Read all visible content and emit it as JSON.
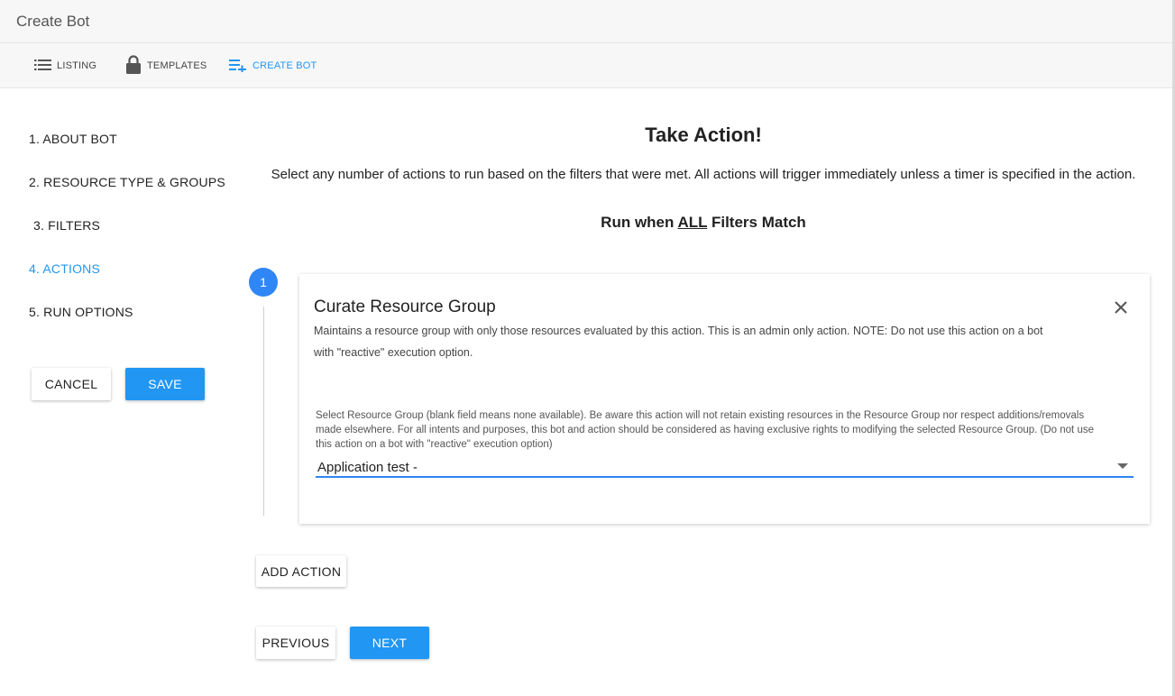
{
  "window": {
    "title": "Create Bot"
  },
  "nav": {
    "listing": {
      "label": "LISTING",
      "icon": "list-icon"
    },
    "templates": {
      "label": "TEMPLATES",
      "icon": "lock-icon"
    },
    "create_bot": {
      "label": "CREATE BOT",
      "icon": "playlist-add-icon"
    }
  },
  "steps": [
    {
      "label": "1. ABOUT BOT"
    },
    {
      "label": "2. RESOURCE TYPE & GROUPS"
    },
    {
      "label": "3. FILTERS"
    },
    {
      "label": "4. ACTIONS",
      "active": true
    },
    {
      "label": "5. RUN OPTIONS"
    }
  ],
  "sidebar_buttons": {
    "cancel": "CANCEL",
    "save": "SAVE"
  },
  "main": {
    "heading": "Take Action!",
    "description": "Select any number of actions to run based on the filters that were met. All actions will trigger immediately unless a timer is specified in the action.",
    "run_prefix": "Run when ",
    "run_emphasis": "ALL",
    "run_suffix": " Filters Match"
  },
  "action": {
    "number": "1",
    "title": "Curate Resource Group",
    "description": "Maintains a resource group with only those resources evaluated by this action. This is an admin only action. NOTE: Do not use this action on a bot with \"reactive\" execution option.",
    "field_label": "Select Resource Group (blank field means none available). Be aware this action will not retain existing resources in the Resource Group nor respect additions/removals made elsewhere. For all intents and purposes, this bot and action should be considered as having exclusive rights to modifying the selected Resource Group. (Do not use this action on a bot with \"reactive\" execution option)",
    "selected_value": "Application test -"
  },
  "buttons": {
    "add_action": "ADD ACTION",
    "previous": "PREVIOUS",
    "next": "NEXT"
  },
  "colors": {
    "accent": "#2196f3",
    "step_circle": "#2f86f6"
  }
}
